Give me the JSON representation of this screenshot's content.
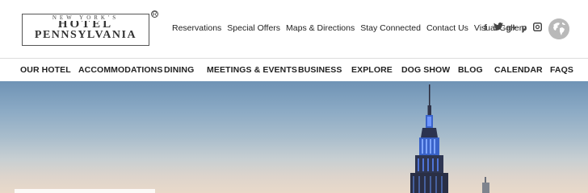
{
  "logo": {
    "tagline": "NEW YORK'S",
    "line1": "HOTEL",
    "line2": "PENNSYLVANIA",
    "registered": "R"
  },
  "util_nav": [
    {
      "label": "Reservations"
    },
    {
      "label": "Special Offers"
    },
    {
      "label": "Maps & Directions"
    },
    {
      "label": "Stay Connected"
    },
    {
      "label": "Contact Us"
    },
    {
      "label": "Visual Gallery"
    }
  ],
  "social": [
    {
      "icon": "facebook-icon",
      "glyph": "f"
    },
    {
      "icon": "twitter-icon",
      "glyph": "t"
    },
    {
      "icon": "google-plus-icon",
      "glyph": "g+"
    },
    {
      "icon": "pinterest-icon",
      "glyph": "p"
    },
    {
      "icon": "instagram-icon",
      "glyph": "◙"
    }
  ],
  "main_nav": [
    {
      "label": "OUR HOTEL"
    },
    {
      "label": "ACCOMMODATIONS"
    },
    {
      "label": "DINING"
    },
    {
      "label": "MEETINGS & EVENTS"
    },
    {
      "label": "BUSINESS"
    },
    {
      "label": "EXPLORE"
    },
    {
      "label": "DOG SHOW"
    },
    {
      "label": "BLOG"
    },
    {
      "label": "CALENDAR"
    },
    {
      "label": "FAQS"
    }
  ],
  "colors": {
    "text": "#222222",
    "divider": "#dddddd",
    "globe": "#b9b9b9",
    "building_lights": "#3a63c9"
  }
}
